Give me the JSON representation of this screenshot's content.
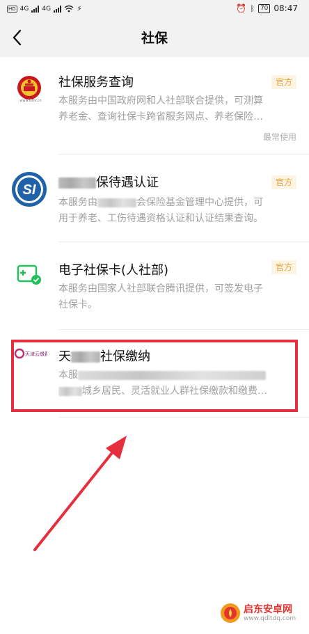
{
  "status_bar": {
    "sim1": "HD",
    "sim2": "HD",
    "net1": "4G",
    "net2": "4G",
    "battery": "70",
    "time": "08:47"
  },
  "nav": {
    "title": "社保"
  },
  "services": [
    {
      "name": "社保服务查询",
      "tag": "官方",
      "desc_line1": "本服务由中国政府网和人社部联合提供，可测算",
      "desc_line2": "养老金、查询社保卡跨省服务网点、养老保险…",
      "footnote": "最常使用",
      "logo_caption": "www.GOV.cn"
    },
    {
      "name_visible": "保待遇认证",
      "tag": "官方",
      "desc_line1_a": "本服务由",
      "desc_line1_b": "会保险基金管理中心提供，可",
      "desc_line2": "用于养老、工伤待遇资格认证和认证结果查询。",
      "logo_text": "SI"
    },
    {
      "name": "电子社保卡(人社部)",
      "tag": "官方",
      "desc_line1": "本服务由国家人社部联合腾讯提供，可签发电子",
      "desc_line2": "社保卡。"
    },
    {
      "name_a": "天",
      "name_b": "社保缴纳",
      "desc_line1_a": "本服",
      "desc_line2_b": "城乡居民、灵活就业人群社保缴款和缴费…",
      "logo_text": "天津云缴费"
    }
  ],
  "watermark": {
    "text": "启东安卓网",
    "url": "www.qdltdq.com"
  },
  "colors": {
    "accent_tag": "#e8a33d",
    "highlight": "#e52e3e",
    "si_blue": "#1f62a8",
    "ecard_green": "#1fbf5a"
  }
}
